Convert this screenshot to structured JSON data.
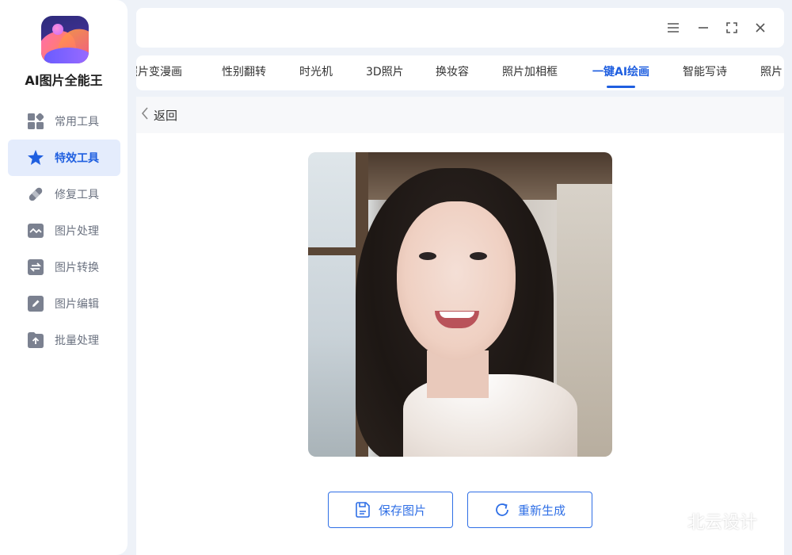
{
  "app": {
    "name": "AI图片全能王"
  },
  "sidebar": {
    "items": [
      {
        "label": "常用工具",
        "icon": "grid-icon",
        "active": false
      },
      {
        "label": "特效工具",
        "icon": "star-icon",
        "active": true
      },
      {
        "label": "修复工具",
        "icon": "bandage-icon",
        "active": false
      },
      {
        "label": "图片处理",
        "icon": "image-icon",
        "active": false
      },
      {
        "label": "图片转换",
        "icon": "convert-icon",
        "active": false
      },
      {
        "label": "图片编辑",
        "icon": "edit-icon",
        "active": false
      },
      {
        "label": "批量处理",
        "icon": "upload-icon",
        "active": false
      }
    ]
  },
  "window_controls": {
    "menu": "menu-icon",
    "minimize": "minimize-icon",
    "maximize": "maximize-icon",
    "close": "close-icon"
  },
  "tabs": [
    {
      "label": "照片变漫画",
      "active": false
    },
    {
      "label": "性别翻转",
      "active": false
    },
    {
      "label": "时光机",
      "active": false
    },
    {
      "label": "3D照片",
      "active": false
    },
    {
      "label": "换妆容",
      "active": false
    },
    {
      "label": "照片加相框",
      "active": false
    },
    {
      "label": "一键AI绘画",
      "active": true
    },
    {
      "label": "智能写诗",
      "active": false
    },
    {
      "label": "照片",
      "active": false
    }
  ],
  "main": {
    "back_label": "返回",
    "save_label": "保存图片",
    "regenerate_label": "重新生成"
  },
  "watermark": {
    "text": "北云设计"
  },
  "colors": {
    "accent": "#1f5fe0",
    "active_bg": "#e4ecfc",
    "background": "#eef2f8"
  }
}
